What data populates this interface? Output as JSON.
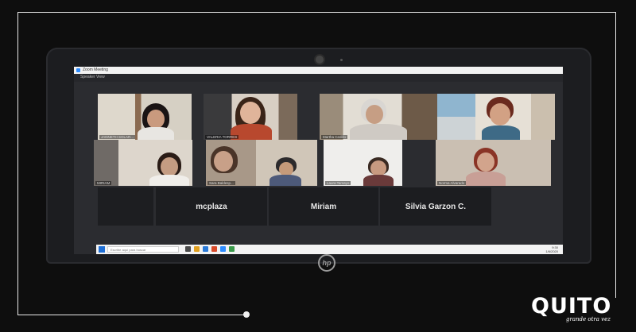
{
  "zoom": {
    "window_title": "Zoom Meeting",
    "sub_title": "Speaker View",
    "participants": [
      {
        "name": "JANNETH SOLAR..."
      },
      {
        "name": "VALERIA TORRES"
      },
      {
        "name": "Martha Cedillo"
      },
      {
        "name": ""
      },
      {
        "name": ""
      },
      {
        "name": "MIRIAM"
      },
      {
        "name": "Sara Baldesp..."
      },
      {
        "name": "Laura Tamayo"
      },
      {
        "name": "Norma Alvarado"
      }
    ],
    "name_tiles": {
      "tile_1": "mcplaza",
      "tile_2": "Miriam",
      "tile_3": "Silvia Garzon C."
    }
  },
  "taskbar": {
    "search_placeholder": "Escribe aquí para buscar",
    "time": "9:30",
    "date": "1/6/2020"
  },
  "brand": {
    "wordmark": "QUITO",
    "tagline": "grande otra vez"
  }
}
